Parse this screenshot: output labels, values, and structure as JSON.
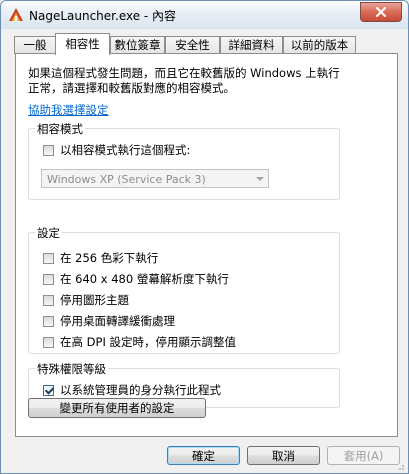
{
  "window": {
    "title": "NageLauncher.exe - 內容"
  },
  "tabs": [
    {
      "label": "一般"
    },
    {
      "label": "相容性"
    },
    {
      "label": "數位簽章"
    },
    {
      "label": "安全性"
    },
    {
      "label": "詳細資料"
    },
    {
      "label": "以前的版本"
    }
  ],
  "intro_lines": [
    "如果這個程式發生問題，而且它在較舊版的 Windows 上執行",
    "正常，請選擇和較舊版對應的相容模式。"
  ],
  "help_link": "協助我選擇設定",
  "compat_mode": {
    "title": "相容模式",
    "checkbox_label": "以相容模式執行這個程式:",
    "checked": false,
    "selected_os": "Windows XP (Service Pack 3)"
  },
  "settings": {
    "title": "設定",
    "items": [
      {
        "label": "在 256 色彩下執行",
        "checked": false
      },
      {
        "label": "在 640 x 480 螢幕解析度下執行",
        "checked": false
      },
      {
        "label": "停用圖形主題",
        "checked": false
      },
      {
        "label": "停用桌面轉譯緩衝處理",
        "checked": false
      },
      {
        "label": "在高 DPI 設定時，停用顯示調整值",
        "checked": false
      }
    ]
  },
  "privilege": {
    "title": "特殊權限等級",
    "checkbox_label": "以系統管理員的身分執行此程式",
    "checked": true
  },
  "all_users_button": "變更所有使用者的設定",
  "buttons": {
    "ok": "確定",
    "cancel": "取消",
    "apply": "套用(A)"
  },
  "colors": {
    "link": "#0066cc",
    "title_gradient_end": "#dae4ef",
    "close_button": "#c84a35"
  }
}
